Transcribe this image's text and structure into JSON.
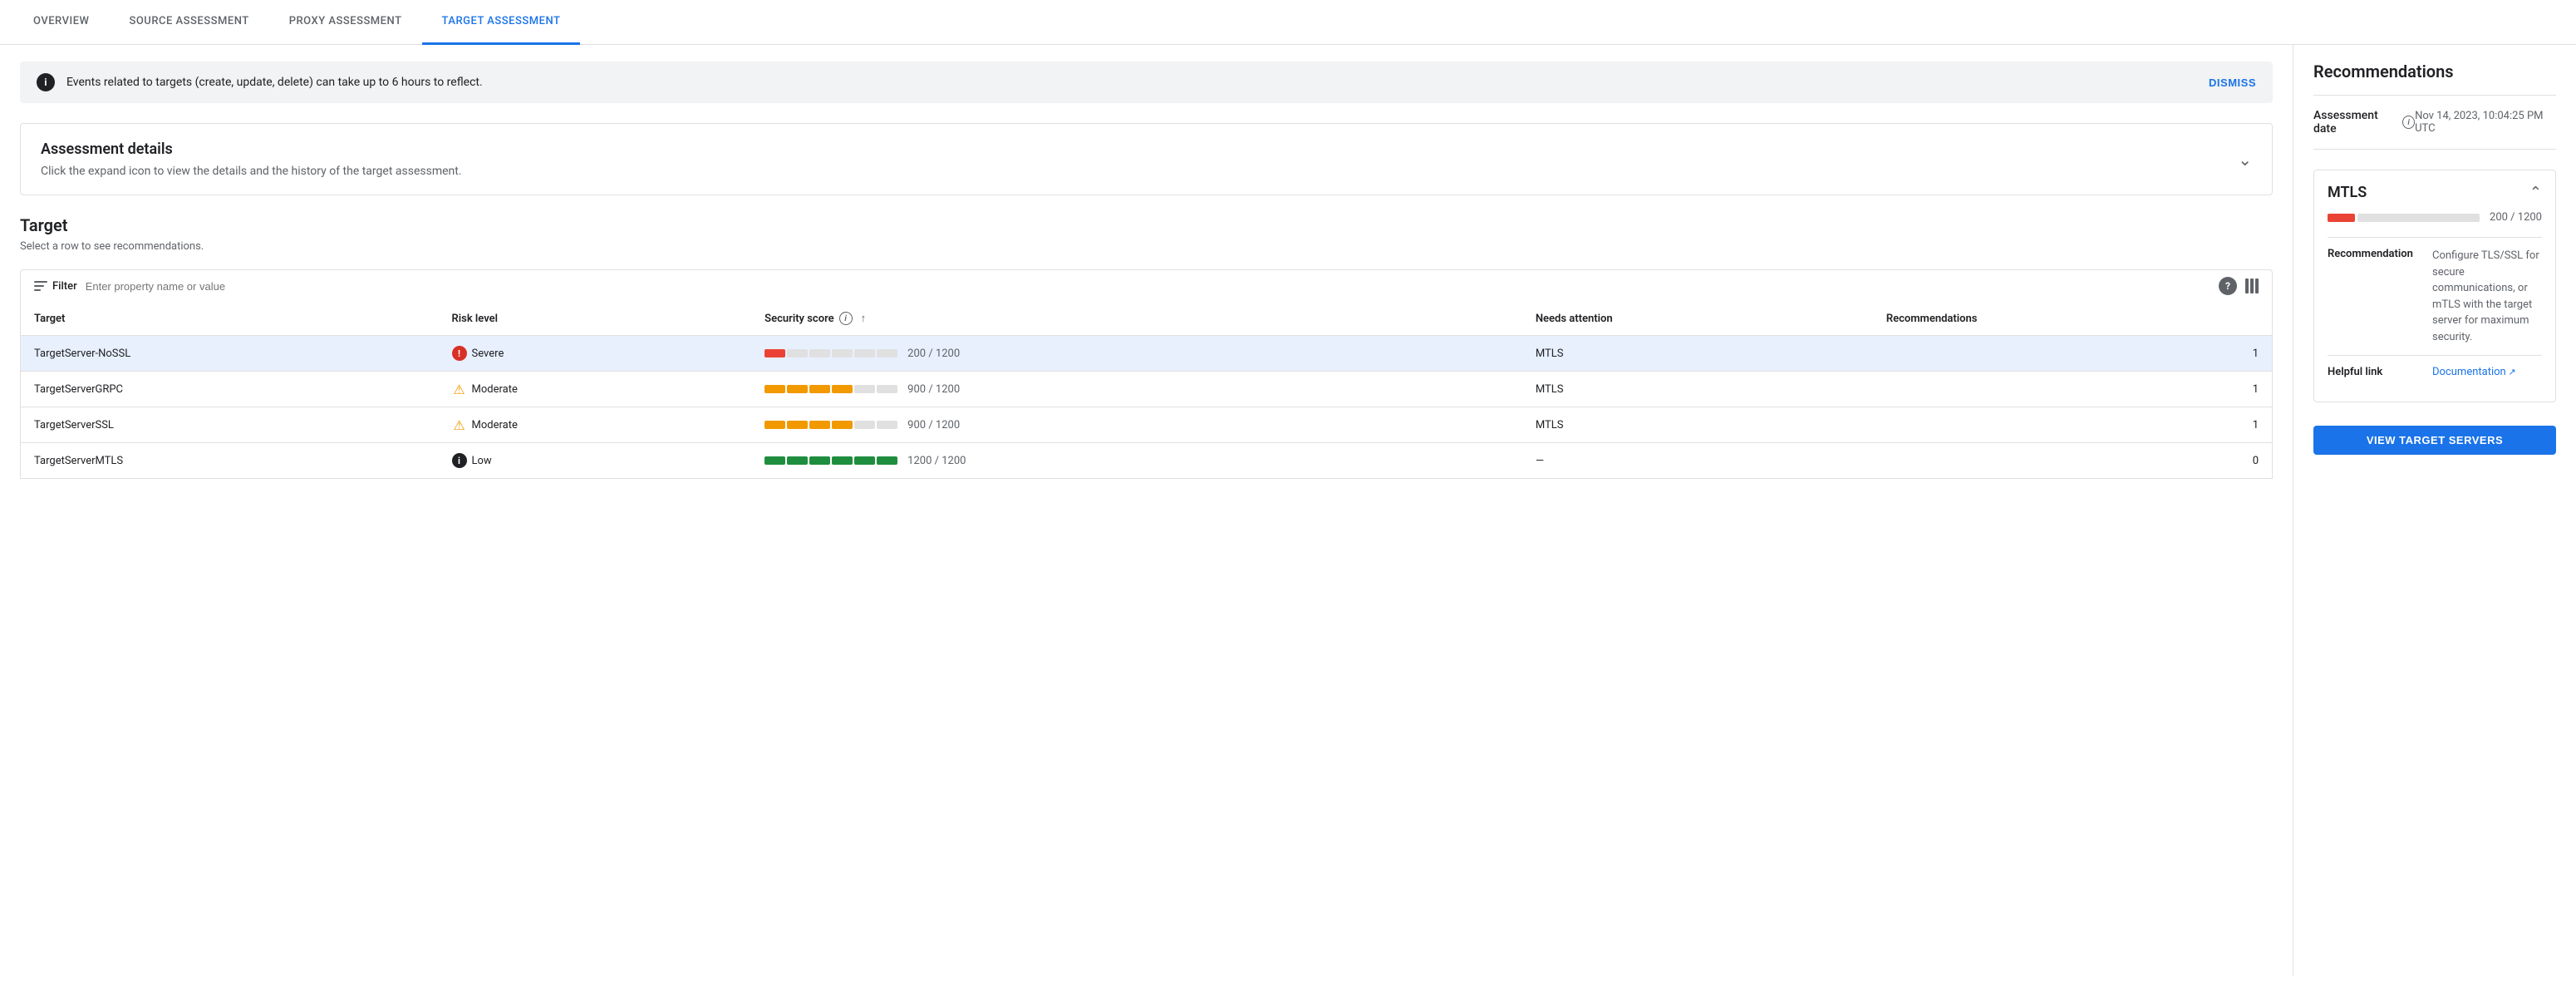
{
  "nav": {
    "tabs": [
      {
        "id": "overview",
        "label": "OVERVIEW",
        "active": false
      },
      {
        "id": "source",
        "label": "SOURCE ASSESSMENT",
        "active": false
      },
      {
        "id": "proxy",
        "label": "PROXY ASSESSMENT",
        "active": false
      },
      {
        "id": "target",
        "label": "TARGET ASSESSMENT",
        "active": true
      }
    ]
  },
  "banner": {
    "text": "Events related to targets (create, update, delete) can take up to 6 hours to reflect.",
    "dismiss_label": "DISMISS"
  },
  "assessment_details": {
    "title": "Assessment details",
    "subtitle": "Click the expand icon to view the details and the history of the target assessment."
  },
  "target_section": {
    "title": "Target",
    "subtitle": "Select a row to see recommendations.",
    "filter_placeholder": "Enter property name or value"
  },
  "table": {
    "columns": [
      {
        "id": "target",
        "label": "Target"
      },
      {
        "id": "risk_level",
        "label": "Risk level"
      },
      {
        "id": "security_score",
        "label": "Security score"
      },
      {
        "id": "needs_attention",
        "label": "Needs attention"
      },
      {
        "id": "recommendations",
        "label": "Recommendations"
      }
    ],
    "rows": [
      {
        "target": "TargetServer-NoSSL",
        "risk_level": "Severe",
        "risk_type": "severe",
        "score_filled": 1,
        "score_total": 6,
        "score_text": "200 / 1200",
        "score_color": "#ea4335",
        "needs_attention": "MTLS",
        "recommendations": "1",
        "selected": true
      },
      {
        "target": "TargetServerGRPC",
        "risk_level": "Moderate",
        "risk_type": "moderate",
        "score_filled": 4,
        "score_total": 6,
        "score_text": "900 / 1200",
        "score_color": "#f29900",
        "needs_attention": "MTLS",
        "recommendations": "1",
        "selected": false
      },
      {
        "target": "TargetServerSSL",
        "risk_level": "Moderate",
        "risk_type": "moderate",
        "score_filled": 4,
        "score_total": 6,
        "score_text": "900 / 1200",
        "score_color": "#f29900",
        "needs_attention": "MTLS",
        "recommendations": "1",
        "selected": false
      },
      {
        "target": "TargetServerMTLS",
        "risk_level": "Low",
        "risk_type": "low",
        "score_filled": 6,
        "score_total": 6,
        "score_text": "1200 / 1200",
        "score_color": "#1e8e3e",
        "needs_attention": "—",
        "recommendations": "0",
        "selected": false
      }
    ]
  },
  "recommendations": {
    "title": "Recommendations",
    "assessment_date_label": "Assessment date",
    "assessment_date_value": "Nov 14, 2023, 10:04:25 PM UTC",
    "mtls": {
      "title": "MTLS",
      "score_text": "200 / 1200",
      "recommendation_label": "Recommendation",
      "recommendation_value": "Configure TLS/SSL for secure communications, or mTLS with the target server for maximum security.",
      "helpful_link_label": "Helpful link",
      "helpful_link_text": "Documentation"
    },
    "view_button_label": "VIEW TARGET SERVERS"
  }
}
